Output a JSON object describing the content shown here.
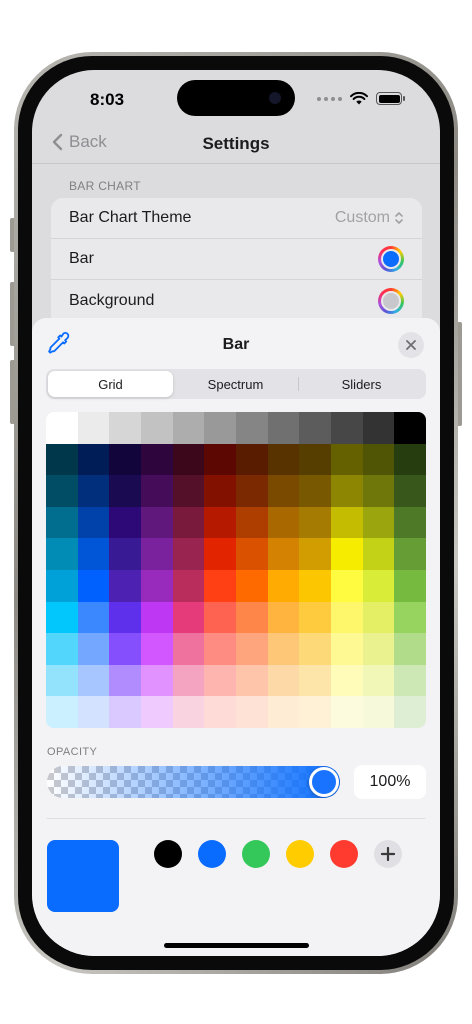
{
  "status": {
    "time": "8:03"
  },
  "nav": {
    "back_label": "Back",
    "title": "Settings"
  },
  "section": {
    "header": "BAR CHART",
    "rows": [
      {
        "label": "Bar Chart Theme",
        "value": "Custom"
      },
      {
        "label": "Bar",
        "swatch_color": "#0a6cff"
      },
      {
        "label": "Background",
        "swatch_color": "#c8c8cc"
      }
    ]
  },
  "picker": {
    "title": "Bar",
    "tabs": [
      "Grid",
      "Spectrum",
      "Sliders"
    ],
    "active_tab": "Grid",
    "opacity_label": "OPACITY",
    "opacity_value": "100%",
    "opacity_fraction": 1.0,
    "current_color": "#0a6cff",
    "saved_colors": [
      "#000000",
      "#0a6cff",
      "#34c759",
      "#ffcc00",
      "#ff3b30"
    ],
    "grid_colors": [
      [
        "#ffffff",
        "#ebebeb",
        "#d6d6d6",
        "#c2c2c2",
        "#adadad",
        "#999999",
        "#858585",
        "#707070",
        "#5c5c5c",
        "#474747",
        "#333333",
        "#000000"
      ],
      [
        "#00374a",
        "#011d57",
        "#11053b",
        "#2e063d",
        "#3c071b",
        "#5c0701",
        "#5a1c00",
        "#583300",
        "#563d00",
        "#666100",
        "#4f5504",
        "#263e0f"
      ],
      [
        "#004d65",
        "#012f7b",
        "#1a0a52",
        "#450d59",
        "#551029",
        "#831100",
        "#7b2900",
        "#7a4a00",
        "#785800",
        "#8c8602",
        "#6f760a",
        "#38571a"
      ],
      [
        "#016e8f",
        "#0042a9",
        "#2c0977",
        "#61187c",
        "#791a3d",
        "#b51a00",
        "#ad3e00",
        "#a96800",
        "#a67b01",
        "#c4bc00",
        "#9ba50e",
        "#4e7a27"
      ],
      [
        "#008cb4",
        "#0056d6",
        "#371a94",
        "#7a219e",
        "#99244f",
        "#e22400",
        "#da5100",
        "#d38301",
        "#d19d01",
        "#f5ec00",
        "#c3d117",
        "#669d34"
      ],
      [
        "#00a1d8",
        "#0061fe",
        "#4d22b2",
        "#982abc",
        "#b92d5d",
        "#ff4015",
        "#ff6a00",
        "#ffab01",
        "#fcc700",
        "#fefb41",
        "#d9ec37",
        "#76bb40"
      ],
      [
        "#01c7fc",
        "#3a87fe",
        "#5e30eb",
        "#be38f3",
        "#e63b7a",
        "#fe6250",
        "#fe8648",
        "#feb43f",
        "#fecb3e",
        "#fff76b",
        "#e4ef65",
        "#96d35f"
      ],
      [
        "#52d6fc",
        "#74a7ff",
        "#864ffe",
        "#d357fe",
        "#ee719e",
        "#ff8c82",
        "#fea57d",
        "#fec777",
        "#fed977",
        "#fff994",
        "#eaf28f",
        "#b1dd8b"
      ],
      [
        "#93e3fc",
        "#a7c6ff",
        "#b18cfe",
        "#e292fe",
        "#f4a4c0",
        "#ffb5af",
        "#ffc5ab",
        "#fed9a8",
        "#fde4a8",
        "#fffbb9",
        "#f1f7b7",
        "#cde8b5"
      ],
      [
        "#cbf0ff",
        "#d3e2ff",
        "#d9c9fe",
        "#efcaff",
        "#f9d3e0",
        "#ffdbd8",
        "#ffe2d6",
        "#feecd4",
        "#fef1d5",
        "#fdfbdd",
        "#f6fadb",
        "#deeed4"
      ]
    ]
  }
}
